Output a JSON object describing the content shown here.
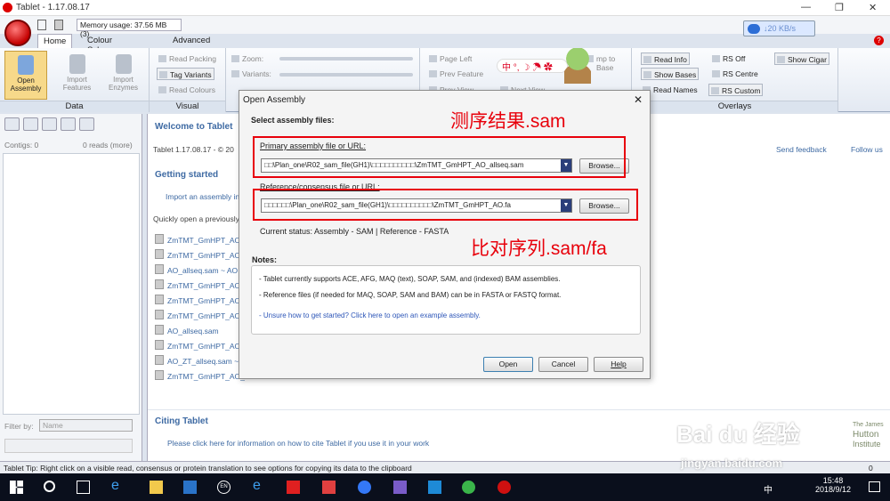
{
  "window": {
    "title": "Tablet - 1.17.08.17",
    "minimize": "—",
    "restore": "❐",
    "close": "✕"
  },
  "toolbar": {
    "memory": "Memory usage: 37.56 MB (3)",
    "net_speed": "↓20 KB/s"
  },
  "tabs": [
    "Home",
    "Colour Schemes",
    "Advanced"
  ],
  "ribbon": {
    "data_group": "Data",
    "visual_group": "Visual",
    "overlays_group": "Overlays",
    "open_assembly": "Open\nAssembly",
    "import_features": "Import\nFeatures",
    "import_enzymes": "Import\nEnzymes",
    "read_packing": "Read Packing",
    "tag_variants": "Tag Variants",
    "read_colours": "Read Colours",
    "zoom": "Zoom:",
    "variants": "Variants:",
    "page_left": "Page Left",
    "prev_feature": "Prev Feature",
    "prev_view": "Prev View",
    "next_view": "Next View",
    "jump_to_base": "mp to Base",
    "read_info": "Read Info",
    "show_bases": "Show Bases",
    "read_names": "Read Names",
    "rs_off": "RS Off",
    "rs_centre": "RS Centre",
    "rs_custom": "RS Custom",
    "show_cigar": "Show Cigar"
  },
  "left_panel": {
    "contigs": "Contigs: 0",
    "reads": "0 reads  (more)",
    "filter_by": "Filter by:",
    "filter_value": "Name"
  },
  "main": {
    "welcome": "Welcome to Tablet",
    "version_line": "Tablet 1.17.08.17 - © 20",
    "send_feedback": "Send feedback",
    "follow_us": "Follow us",
    "getting_started": "Getting started",
    "import_assembly": "Import an assembly in",
    "quick_open": "Quickly open a previously",
    "recent": [
      "ZmTMT_GmHPT_AO_a",
      "ZmTMT_GmHPT_AO_a",
      "AO_allseq.sam  ~  AO",
      "ZmTMT_GmHPT_AO_a",
      "ZmTMT_GmHPT_AO_a",
      "ZmTMT_GmHPT_AO_a",
      "AO_allseq.sam",
      "ZmTMT_GmHPT_AO_a",
      "AO_ZT_allseq.sam  ~",
      "ZmTMT_GmHPT_AO_a"
    ],
    "citing_tablet": "Citing Tablet",
    "cite_text": "Please click here for information on how to cite Tablet if you use it in your work",
    "logo_small": "The James",
    "logo_big": "Hutton",
    "logo_big2": "Institute"
  },
  "dialog": {
    "title": "Open Assembly",
    "close": "✕",
    "select_label": "Select assembly files:",
    "primary_label": "Primary assembly file or URL:",
    "primary_value": "□□\\Plan_one\\R02_sam_file(GH1)\\□□□□□□□□□□\\ZmTMT_GmHPT_AO_allseq.sam",
    "browse1": "Browse...",
    "reference_label": "Reference/consensus file or URL:",
    "reference_value": "□□□□□□\\Plan_one\\R02_sam_file(GH1)\\□□□□□□□□□□\\ZmTMT_GmHPT_AO.fa",
    "browse2": "Browse...",
    "current_status": "Current status:  Assembly - SAM  |  Reference - FASTA",
    "notes_label": "Notes:",
    "note1": "- Tablet currently supports ACE, AFG, MAQ (text), SOAP, SAM, and (indexed) BAM assemblies.",
    "note2": "- Reference files (if needed for MAQ, SOAP, SAM and BAM) can be in FASTA or FASTQ format.",
    "note3": "- Unsure how to get started? Click here to open an example assembly.",
    "open": "Open",
    "cancel": "Cancel",
    "help": "Help"
  },
  "annotations": {
    "top": "测序结果.sam",
    "bottom": "比对序列.sam/fa"
  },
  "status_bar": {
    "tip": "Tablet Tip:  Right click on a visible read, consensus or protein translation to see options for copying its data to the clipboard",
    "right": "0"
  },
  "taskbar": {
    "time": "15:48",
    "date": "2018/9/12",
    "ime": "中",
    "lang": "EN"
  },
  "watermark": {
    "brand": "Bai du 经验",
    "url": "jingyan.baidu.com"
  },
  "colors": {
    "accent_red": "#e8000b",
    "link_blue": "#3e6aa3",
    "ribbon_bg": "#e3e9f2"
  }
}
